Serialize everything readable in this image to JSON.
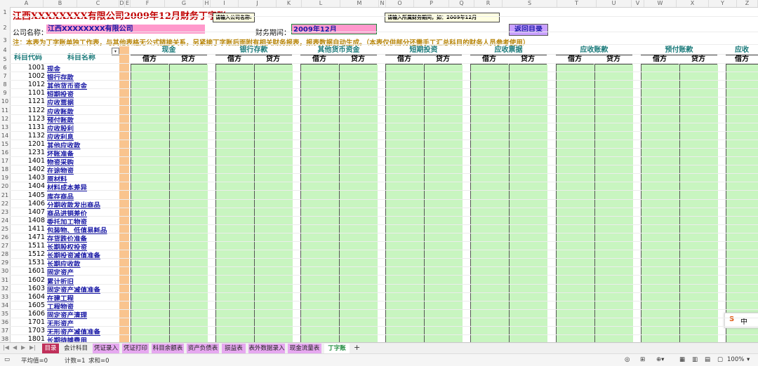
{
  "title": "江西XXXXXXXX有限公司2009年12月财务丁字账",
  "comments": {
    "company": "请输入公司名称:",
    "period": "请输入所属财务期间，如：2009年12月"
  },
  "company": {
    "label": "公司名称：",
    "value": "江西XXXXXXXX有限公司"
  },
  "period": {
    "label": "财务期间：",
    "value": "2009年12月"
  },
  "back_button": "返回目录",
  "notice": "注：本表为丁字账单独工作表，与其他表格无公式链接关系，另紧接丁字账后面附有相关财务报表，报表数据自动生成。（本表仅供部分还需手工汇总科目的财务人员参考使用）",
  "column_letters": [
    "A",
    "B",
    "C",
    "D",
    "E",
    "F",
    "G",
    "H",
    "I",
    "J",
    "K",
    "L",
    "M",
    "N",
    "O",
    "P",
    "Q",
    "R",
    "S",
    "T",
    "U",
    "V",
    "W",
    "X",
    "Y",
    "Z"
  ],
  "row_numbers": [
    "1",
    "2",
    "3",
    "4",
    "5",
    "6",
    "7",
    "8",
    "9",
    "10",
    "11",
    "12",
    "13",
    "14",
    "15",
    "16",
    "17",
    "18",
    "19",
    "20",
    "21",
    "22",
    "23",
    "24",
    "25",
    "26",
    "27",
    "28",
    "29",
    "30",
    "31",
    "32",
    "33",
    "34",
    "35",
    "36",
    "37",
    "38"
  ],
  "left_headers": {
    "code": "科目代码",
    "name": "科目名称"
  },
  "debit": "借方",
  "credit": "贷方",
  "account_headers": [
    "现金",
    "银行存款",
    "其他货币资金",
    "短期投资",
    "应收票据",
    "应收账款",
    "预付账款",
    "应收"
  ],
  "accounts": [
    {
      "code": "1001",
      "name": "现金"
    },
    {
      "code": "1002",
      "name": "银行存款"
    },
    {
      "code": "1012",
      "name": "其他货币资金"
    },
    {
      "code": "1101",
      "name": "短期投资"
    },
    {
      "code": "1121",
      "name": "应收票据"
    },
    {
      "code": "1122",
      "name": "应收账款"
    },
    {
      "code": "1123",
      "name": "预付账款"
    },
    {
      "code": "1131",
      "name": "应收股利"
    },
    {
      "code": "1132",
      "name": "应收利息"
    },
    {
      "code": "1201",
      "name": "其他应收款"
    },
    {
      "code": "1231",
      "name": "坏账准备"
    },
    {
      "code": "1401",
      "name": "物资采购"
    },
    {
      "code": "1402",
      "name": "在途物资"
    },
    {
      "code": "1403",
      "name": "原材料"
    },
    {
      "code": "1404",
      "name": "材料成本差异"
    },
    {
      "code": "1405",
      "name": "库存商品"
    },
    {
      "code": "1406",
      "name": "分期收款发出商品"
    },
    {
      "code": "1407",
      "name": "商品进销差价"
    },
    {
      "code": "1408",
      "name": "委托加工物资"
    },
    {
      "code": "1411",
      "name": "包装物、低值易耗品"
    },
    {
      "code": "1471",
      "name": "存货跌价准备"
    },
    {
      "code": "1511",
      "name": "长期股权投资"
    },
    {
      "code": "1512",
      "name": "长期投资减值准备"
    },
    {
      "code": "1531",
      "name": "长期应收款"
    },
    {
      "code": "1601",
      "name": "固定资产"
    },
    {
      "code": "1602",
      "name": "累计折旧"
    },
    {
      "code": "1603",
      "name": "固定资产减值准备"
    },
    {
      "code": "1604",
      "name": "在建工程"
    },
    {
      "code": "1605",
      "name": "工程物资"
    },
    {
      "code": "1606",
      "name": "固定资产清理"
    },
    {
      "code": "1701",
      "name": "无形资产"
    },
    {
      "code": "1703",
      "name": "无形资产减值准备"
    },
    {
      "code": "1801",
      "name": "长期待摊费用"
    }
  ],
  "sheet_tabs": [
    {
      "label": "目录",
      "color": "#c0305a",
      "text": "#ffffff"
    },
    {
      "label": "会计科目",
      "color": "#f0f0f0",
      "text": "#222222"
    },
    {
      "label": "凭证录入",
      "color": "#e6a8f0",
      "text": "#222222"
    },
    {
      "label": "凭证打印",
      "color": "#e6a8f0",
      "text": "#222222"
    },
    {
      "label": "科目余额表",
      "color": "#e6a8f0",
      "text": "#222222"
    },
    {
      "label": "资产负债表",
      "color": "#e6a8f0",
      "text": "#222222"
    },
    {
      "label": "损益表",
      "color": "#e6a8f0",
      "text": "#222222"
    },
    {
      "label": "表外数据录入",
      "color": "#e6a8f0",
      "text": "#222222"
    },
    {
      "label": "现金流量表",
      "color": "#e6a8f0",
      "text": "#222222"
    },
    {
      "label": "丁字账",
      "color": "#ffffff",
      "text": "#1d8a3c"
    }
  ],
  "add_sheet": "+",
  "status": {
    "avg": "平均值=0",
    "count": "计数=1",
    "sum": "求和=0",
    "zoom": "100%"
  },
  "ime": "中"
}
